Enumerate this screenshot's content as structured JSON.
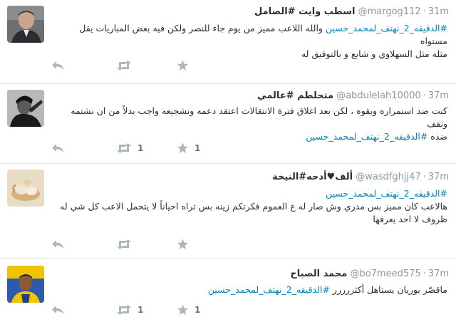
{
  "tweets": [
    {
      "name": "اسطب وايت #الصامل",
      "handle": "@margog112",
      "time": "31m",
      "lines": [
        [
          {
            "t": "#الدقيقه_2_نهتف_لمحمد_حسين",
            "h": true
          },
          {
            "t": " والله اللاعب مميز من يوم جاء للنصر ولكن فيه بعض المباريات يقل مستواه",
            "h": false
          }
        ],
        [
          {
            "t": "مثله مثل السهلاوي و شايع و بالتوفيق له",
            "h": false
          }
        ]
      ],
      "retweets": "",
      "favorites": ""
    },
    {
      "name": "متحلطم #عالمي",
      "handle": "@abdulelah10000",
      "time": "37m",
      "lines": [
        [
          {
            "t": "كنت ضد استمراره وبقوه ، لكن بعد اغلاق فترة الانتقالات اعتقد دعمه وتشجيعه واجب بدلاً من ان نشتمه ونقف",
            "h": false
          }
        ],
        [
          {
            "t": "ضده ",
            "h": false
          },
          {
            "t": "#الدقيقه_2_نهتف_لمحمد_حسين",
            "h": true
          }
        ]
      ],
      "retweets": "1",
      "favorites": "1"
    },
    {
      "name": "ألف♥أدحه#النيخة",
      "handle": "@wasdfghjj47",
      "time": "37m",
      "lines": [
        [
          {
            "t": "#الدقيقه_2_نهتف_لمحمد_حسين",
            "h": true
          }
        ],
        [
          {
            "t": "هالاعب كان مميز بس مدري وش صار له ع العموم فكرتكم زينه بس تراه احياناً لا يتحمل الاعب كل شي له",
            "h": false
          }
        ],
        [
          {
            "t": "ظروف لا احد يعرفها",
            "h": false
          }
        ]
      ],
      "retweets": "",
      "favorites": ""
    },
    {
      "name": "محمد الصباح",
      "handle": "@bo7meed575",
      "time": "37m",
      "lines": [
        [
          {
            "t": "ماقصّر بوريان يستاهل أكثررررر ",
            "h": false
          },
          {
            "t": "#الدقيقه_2_نهتف_لمحمد_حسين",
            "h": true
          }
        ]
      ],
      "retweets": "1",
      "favorites": "1"
    }
  ],
  "icons": {
    "reply": "reply-icon",
    "retweet": "retweet-icon",
    "favorite": "star-icon"
  },
  "colors": {
    "hashtag": "#0084b4",
    "icon": "#aab8c2",
    "meta": "#8899a6",
    "text": "#292f33"
  }
}
